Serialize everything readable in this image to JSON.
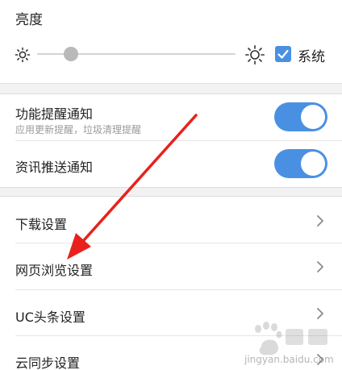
{
  "brightness": {
    "title": "亮度",
    "level": 0.17,
    "system_label": "系统",
    "system_checked": true,
    "icon_min": "sun-dim-icon",
    "icon_max": "sun-bright-icon"
  },
  "notifications": {
    "items": [
      {
        "label": "功能提醒通知",
        "sublabel": "应用更新提醒，垃圾清理提醒",
        "enabled": true
      },
      {
        "label": "资讯推送通知",
        "enabled": true
      }
    ]
  },
  "nav": {
    "items": [
      {
        "label": "下载设置"
      },
      {
        "label": "网页浏览设置"
      },
      {
        "label": "UC头条设置"
      },
      {
        "label": "云同步设置"
      }
    ]
  },
  "watermark": {
    "site": "jingyan.baidu.com"
  },
  "colors": {
    "accent": "#4a90e2",
    "annotation_arrow": "#e8211c",
    "background": "#f2f2f2"
  }
}
